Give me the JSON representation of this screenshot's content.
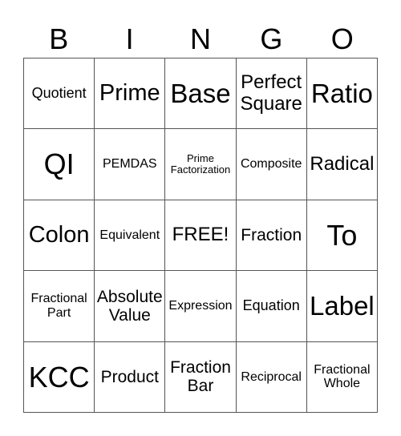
{
  "header": [
    "B",
    "I",
    "N",
    "G",
    "O"
  ],
  "cells": [
    [
      "Quotient",
      "Prime",
      "Base",
      "Perfect\nSquare",
      "Ratio"
    ],
    [
      "QI",
      "PEMDAS",
      "Prime\nFactorization",
      "Composite",
      "Radical"
    ],
    [
      "Colon",
      "Equivalent",
      "FREE!",
      "Fraction",
      "To"
    ],
    [
      "Fractional\nPart",
      "Absolute\nValue",
      "Expression",
      "Equation",
      "Label"
    ],
    [
      "KCC",
      "Product",
      "Fraction\nBar",
      "Reciprocal",
      "Fractional\nWhole"
    ]
  ]
}
